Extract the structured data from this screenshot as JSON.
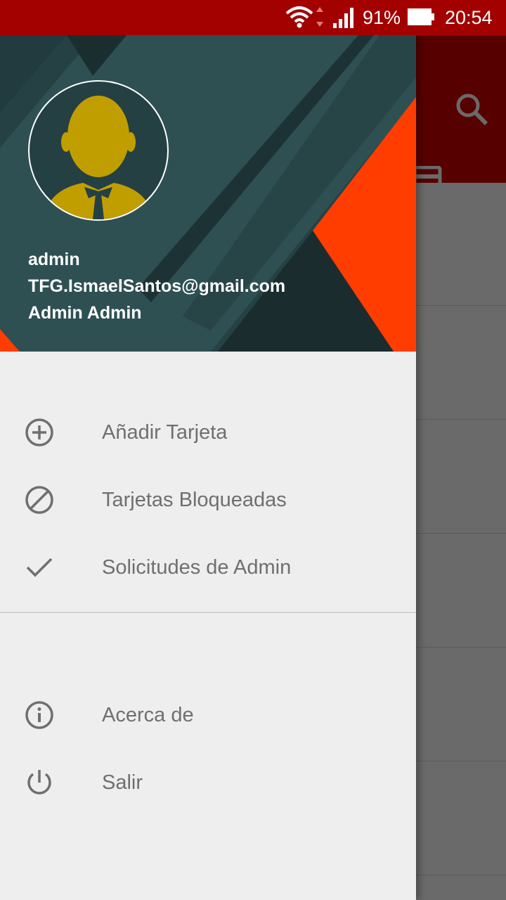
{
  "status_bar": {
    "battery_percent": "91%",
    "time": "20:54",
    "icons": [
      "wifi-icon",
      "signal-icon",
      "battery-icon"
    ]
  },
  "drawer": {
    "header": {
      "username": "admin",
      "email": "TFG.IsmaelSantos@gmail.com",
      "full_name": "Admin Admin"
    },
    "menu_primary": [
      {
        "label": "Añadir Tarjeta",
        "icon": "add-circle-icon"
      },
      {
        "label": "Tarjetas Bloqueadas",
        "icon": "block-icon"
      },
      {
        "label": "Solicitudes de Admin",
        "icon": "check-icon"
      }
    ],
    "menu_secondary": [
      {
        "label": "Acerca de",
        "icon": "info-icon"
      },
      {
        "label": "Salir",
        "icon": "power-icon"
      }
    ]
  },
  "background_app": {
    "toolbar_icons": [
      "search-icon",
      "credit-card-icon"
    ]
  },
  "colors": {
    "status_bar": "#a30000",
    "toolbar": "#570000",
    "header_dark": "#254144",
    "header_accent": "#ff3d00",
    "avatar_gold": "#c19e00",
    "drawer_bg": "#eeeeee",
    "menu_text": "#6f6f6f"
  }
}
